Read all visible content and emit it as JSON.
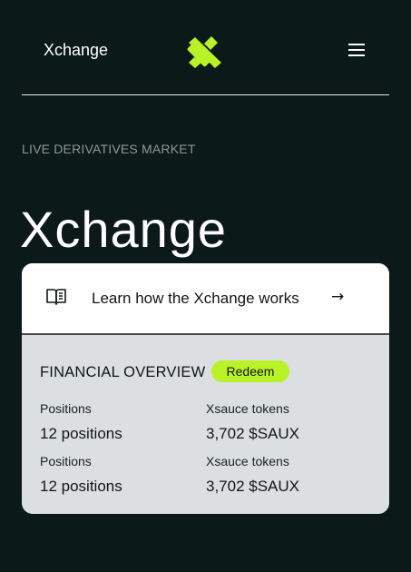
{
  "header": {
    "brand": "Xchange",
    "logo_icon": "x-logo-icon",
    "menu_icon": "hamburger-menu-icon"
  },
  "hero": {
    "eyebrow": "LIVE DERIVATIVES MARKET",
    "title": "Xchange"
  },
  "card": {
    "learn": {
      "icon": "book-icon",
      "label": "Learn how the Xchange works",
      "arrow": "→"
    },
    "overview": {
      "heading": "FINANCIAL OVERVIEW",
      "redeem_label": "Redeem",
      "stats": [
        {
          "label": "Positions",
          "value": "12 positions"
        },
        {
          "label": "Xsauce tokens",
          "value": "3,702 $SAUX"
        },
        {
          "label": "Positions",
          "value": "12 positions"
        },
        {
          "label": "Xsauce tokens",
          "value": "3,702 $SAUX"
        }
      ]
    }
  },
  "colors": {
    "background": "#0b1918",
    "accent": "#b9f227",
    "card_bottom": "#dcdfe1",
    "card_top": "#ffffff"
  }
}
